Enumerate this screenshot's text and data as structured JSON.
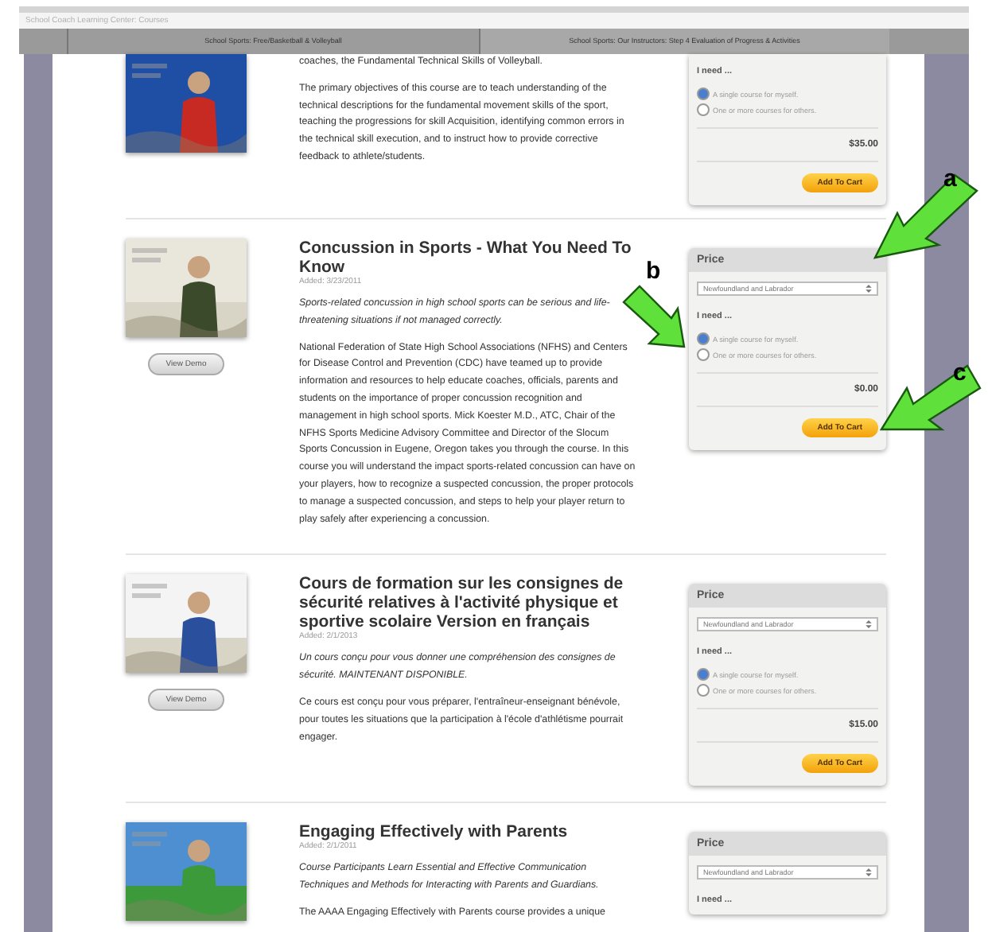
{
  "window": {
    "title": "School Coach Learning Center: Courses"
  },
  "tabs": [
    {
      "label": "School Sports: Free/Basketball & Volleyball",
      "selected": false
    },
    {
      "label": "School Sports: Our Instructors: Step 4 Evaluation of Progress & Activities",
      "selected": true
    }
  ],
  "courses": [
    {
      "picture": {
        "kind": "picture"
      },
      "paragraphs": [
        {
          "kind": "body",
          "text": "coaches, the Fundamental Technical Skills of Volleyball."
        },
        {
          "kind": "body",
          "text": "The primary objectives of this course are to teach understanding of the technical descriptions for the fundamental movement skills of the sport, teaching the progressions for skill Acquisition, identifying common errors in the technical skill execution, and to instruct how to provide corrective feedback to athlete/students."
        }
      ],
      "price": {
        "prompt": "I need ...",
        "options": [
          {
            "label": "A single course for myself.",
            "selected": true
          },
          {
            "label": "One or more courses for others.",
            "selected": false
          }
        ],
        "amount": "$35.00",
        "button": "Add To Cart"
      }
    },
    {
      "picture": {
        "kind": "picture"
      },
      "demo": "View Demo",
      "title": "Concussion in Sports - What You Need To Know",
      "added": "Added: 3/23/2011",
      "paragraphs": [
        {
          "kind": "summary",
          "text": "Sports-related concussion in high school sports can be serious and life-threatening situations if not managed correctly."
        },
        {
          "kind": "body",
          "text": "National Federation of State High School Associations (NFHS) and Centers for Disease Control and Prevention (CDC) have teamed up to provide information and resources to help educate coaches, officials, parents and students on the importance of proper concussion recognition and management in high school sports. Mick Koester M.D., ATC, Chair of the NFHS Sports Medicine Advisory Committee and Director of the Slocum Sports Concussion in Eugene, Oregon takes you through the course. In this course you will understand the impact sports-related concussion can have on your players, how to recognize a suspected concussion, the proper protocols to manage a suspected concussion, and steps to help your player return to play safely after experiencing a concussion."
        }
      ],
      "price": {
        "heading": "Price",
        "region": "Newfoundland and Labrador",
        "prompt": "I need ...",
        "options": [
          {
            "label": "A single course for myself.",
            "selected": true
          },
          {
            "label": "One or more courses for others.",
            "selected": false
          }
        ],
        "amount": "$0.00",
        "button": "Add To Cart"
      }
    },
    {
      "picture": {
        "kind": "picture"
      },
      "demo": "View Demo",
      "title": "Cours de formation sur les consignes de sécurité relatives à l'activité physique et sportive scolaire Version en français",
      "added": "Added: 2/1/2013",
      "paragraphs": [
        {
          "kind": "summary",
          "text": "Un cours conçu pour vous donner une compréhension des consignes de sécurité. MAINTENANT DISPONIBLE."
        },
        {
          "kind": "body",
          "text": "Ce cours est conçu pour vous préparer, l'entraîneur-enseignant bénévole, pour toutes les situations que la participation à l'école d'athlétisme pourrait engager."
        }
      ],
      "price": {
        "heading": "Price",
        "region": "Newfoundland and Labrador",
        "prompt": "I need ...",
        "options": [
          {
            "label": "A single course for myself.",
            "selected": true
          },
          {
            "label": "One or more courses for others.",
            "selected": false
          }
        ],
        "amount": "$15.00",
        "button": "Add To Cart"
      }
    },
    {
      "picture": {
        "kind": "picture"
      },
      "title": "Engaging Effectively with Parents",
      "added": "Added: 2/1/2011",
      "paragraphs": [
        {
          "kind": "summary",
          "text": "Course Participants Learn Essential and Effective Communication Techniques and Methods for Interacting with Parents and Guardians."
        },
        {
          "kind": "body",
          "text": "The AAAA Engaging Effectively with Parents course provides a unique"
        }
      ],
      "price": {
        "heading": "Price",
        "region": "Newfoundland and Labrador",
        "prompt": "I need ..."
      }
    }
  ],
  "annotations": [
    {
      "label": "a"
    },
    {
      "label": "b"
    },
    {
      "label": "c"
    }
  ]
}
